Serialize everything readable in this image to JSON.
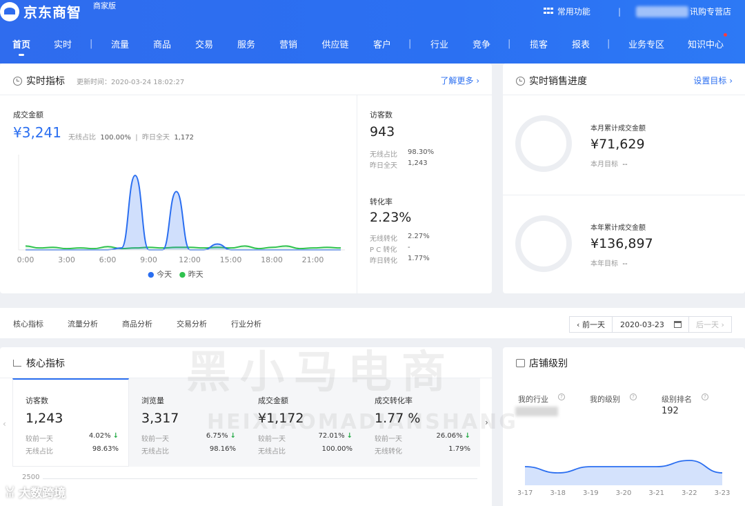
{
  "header": {
    "logo": "京东商智",
    "edition": "商家版",
    "common_functions": "常用功能",
    "store_suffix": "讯购专营店",
    "nav": [
      "首页",
      "实时",
      "流量",
      "商品",
      "交易",
      "服务",
      "营销",
      "供应链",
      "客户",
      "行业",
      "竞争",
      "揽客",
      "报表",
      "业务专区",
      "知识中心"
    ],
    "active_nav": "首页"
  },
  "realtime": {
    "title": "实时指标",
    "update_label": "更新时间：2020-03-24 18:02:27",
    "more_link": "了解更多 ›",
    "gmv_label": "成交金额",
    "gmv_value": "¥3,241",
    "gmv_mobile_label": "无线占比",
    "gmv_mobile_value": "100.00%",
    "gmv_yday_label": "昨日全天",
    "gmv_yday_value": "1,172",
    "visitors_label": "访客数",
    "visitors_value": "943",
    "visitors_mobile_label": "无线占比",
    "visitors_mobile_value": "98.30%",
    "visitors_yday_label": "昨日全天",
    "visitors_yday_value": "1,243",
    "cvr_label": "转化率",
    "cvr_value": "2.23%",
    "cvr_mobile_label": "无线转化",
    "cvr_mobile_value": "2.27%",
    "cvr_pc_label": "P C 转化",
    "cvr_pc_value": "-",
    "cvr_yday_label": "昨日转化",
    "cvr_yday_value": "1.77%",
    "legend_today": "今天",
    "legend_yesterday": "昨天"
  },
  "chart_data": [
    {
      "type": "area",
      "x_ticks": [
        "0:00",
        "3:00",
        "6:00",
        "9:00",
        "12:00",
        "15:00",
        "18:00",
        "21:00"
      ],
      "x": [
        0,
        1,
        2,
        3,
        4,
        5,
        6,
        7,
        8,
        9,
        10,
        11,
        12,
        13,
        14,
        15,
        16,
        17,
        18,
        19,
        20,
        21,
        22,
        23
      ],
      "series": [
        {
          "name": "今天",
          "color": "#2a6ef0",
          "values": [
            0,
            0,
            0,
            0,
            0,
            0,
            0,
            30,
            1150,
            0,
            0,
            900,
            0,
            0,
            90,
            0,
            0,
            0,
            0,
            0,
            0,
            0,
            0,
            0
          ]
        },
        {
          "name": "昨天",
          "color": "#2fc24e",
          "values": [
            60,
            30,
            40,
            20,
            30,
            20,
            50,
            20,
            30,
            40,
            30,
            40,
            40,
            30,
            40,
            30,
            60,
            20,
            40,
            60,
            20,
            30,
            40,
            30
          ]
        }
      ],
      "ylim": [
        0,
        1300
      ]
    },
    {
      "type": "area",
      "categories": [
        "3-17",
        "3-18",
        "3-19",
        "3-20",
        "3-21",
        "3-22",
        "3-23"
      ],
      "values": [
        3,
        2,
        3,
        3,
        3,
        4,
        2
      ],
      "ylim": [
        0,
        6
      ]
    }
  ],
  "sales": {
    "title": "实时销售进度",
    "set_goal": "设置目标 ›",
    "month_label": "本月累计成交金额",
    "month_value": "¥71,629",
    "month_target_label": "本月目标",
    "month_target_value": "--",
    "year_label": "本年累计成交金额",
    "year_value": "¥136,897",
    "year_target_label": "本年目标",
    "year_target_value": "--"
  },
  "tabs": [
    "核心指标",
    "流量分析",
    "商品分析",
    "交易分析",
    "行业分析"
  ],
  "date": {
    "prev": "‹ 前一天",
    "value": "2020-03-23",
    "next": "后一天 ›"
  },
  "core": {
    "title": "核心指标",
    "compare_label": "较前一天",
    "metrics": [
      {
        "label": "访客数",
        "value": "1,243",
        "change": "4.02%",
        "second_label": "无线占比",
        "second_value": "98.63%"
      },
      {
        "label": "浏览量",
        "value": "3,317",
        "change": "6.75%",
        "second_label": "无线占比",
        "second_value": "98.16%"
      },
      {
        "label": "成交金额",
        "value": "¥1,172",
        "change": "72.01%",
        "second_label": "无线占比",
        "second_value": "100.00%"
      },
      {
        "label": "成交转化率",
        "value": "1.77 %",
        "change": "26.06%",
        "second_label": "无线转化",
        "second_value": "1.79%"
      }
    ],
    "y_tick": "2500"
  },
  "store_level": {
    "title": "店铺级别",
    "industry_label": "我的行业",
    "level_label": "我的级别",
    "rank_label": "级别排名",
    "rank_value": "192"
  },
  "watermarks": {
    "footer": "大数跨境",
    "center_cn": "黑小马电商",
    "center_en": "HEIXIAOMADIANSHANG"
  }
}
